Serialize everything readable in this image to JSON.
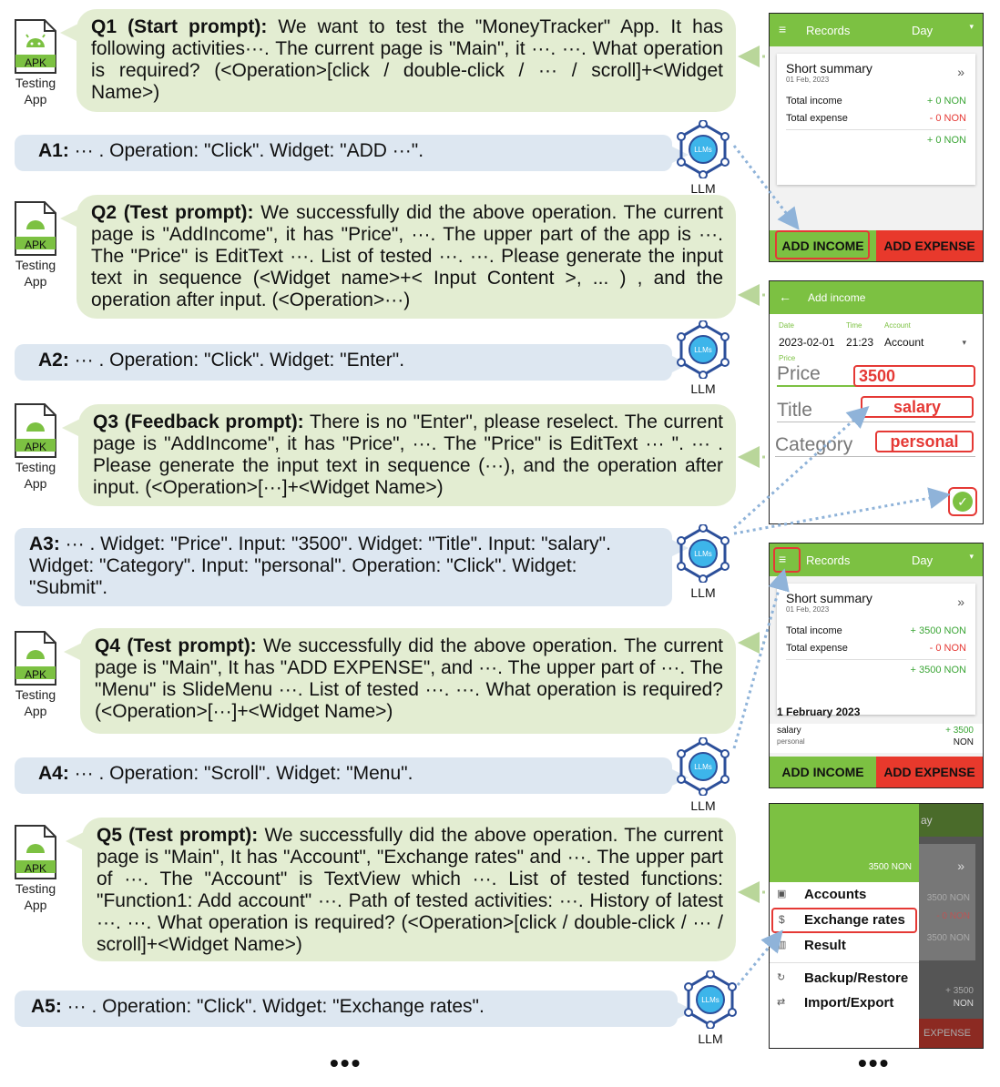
{
  "apk": {
    "badge": "APK",
    "label1": "Testing",
    "label2": "App"
  },
  "llm": {
    "inner": "LLMs",
    "label": "LLM"
  },
  "q1": {
    "title": "Q1 (Start prompt):",
    "text": " We want to test the \"MoneyTracker\" App. It has following activities···. The current page is \"Main\", it ···. ···. What operation is required? (<Operation>[click / double-click / ··· / scroll]+<Widget Name>)"
  },
  "a1": {
    "title": "A1:",
    "text": " ··· . Operation: \"Click\". Widget: \"ADD ···\"."
  },
  "q2": {
    "title": "Q2 (Test prompt):",
    "text": " We successfully did the above operation. The current page is \"AddIncome\", it has \"Price\", ···. The upper part of the app is ···. The \"Price\" is EditText ···. List of tested ···. ···. Please generate the input text in sequence (<Widget name>+< Input Content >, ... ) , and the operation after input. (<Operation>···)"
  },
  "a2": {
    "title": "A2:",
    "text": " ··· .  Operation: \"Click\". Widget: \"Enter\"."
  },
  "q3": {
    "title": "Q3 (Feedback prompt):",
    "text": " There is no \"Enter\", please reselect. The current page is \"AddIncome\", it has \"Price\", ···. The \"Price\" is EditText ··· \". ··· . Please generate the input text in sequence (···), and the operation after input. (<Operation>[···]+<Widget Name>)"
  },
  "a3": {
    "title": "A3:",
    "text": " ··· . Widget: \"Price\". Input: \"3500\". Widget: \"Title\". Input: \"salary\". Widget: \"Category\". Input: \"personal\". Operation: \"Click\". Widget: \"Submit\"."
  },
  "q4": {
    "title": "Q4 (Test prompt):",
    "text": " We successfully did the above operation. The current page is \"Main\", It has \"ADD EXPENSE\", and ···. The upper part of  ···. The \"Menu\" is SlideMenu ···. List of tested ···. ···. What operation is required? (<Operation>[···]+<Widget Name>)"
  },
  "a4": {
    "title": "A4:",
    "text": " ··· . Operation: \"Scroll\". Widget: \"Menu\"."
  },
  "q5": {
    "title": "Q5 (Test prompt):",
    "text": " We successfully did the above operation. The current page is \"Main\", It has \"Account\", \"Exchange rates\" and ···. The upper part of ···. The \"Account\" is TextView which ···. List of tested functions: \"Function1: Add account\" ···. Path of tested activities: ···. History of latest ···. ···. What operation is required? (<Operation>[click / double-click / ··· / scroll]+<Widget Name>)"
  },
  "a5": {
    "title": "A5:",
    "text": " ··· . Operation: \"Click\". Widget: \"Exchange rates\"."
  },
  "dots": "•••",
  "s1": {
    "bar_title": "Records",
    "bar_period": "Day",
    "card_title": "Short summary",
    "date": "01 Feb, 2023",
    "income_label": "Total income",
    "income_val": "+ 0 NON",
    "expense_label": "Total expense",
    "expense_val": "- 0 NON",
    "total_val": "+ 0 NON",
    "add_income": "ADD INCOME",
    "add_expense": "ADD EXPENSE",
    "chev": "»"
  },
  "s2": {
    "bar_title": "Add income",
    "date_lbl": "Date",
    "time_lbl": "Time",
    "account_lbl": "Account",
    "date": "2023-02-01",
    "time": "21:23",
    "account": "Account",
    "price_small": "Price",
    "price": "Price",
    "price_val": "3500",
    "title": "Title",
    "title_val": "salary",
    "category": "Category",
    "category_val": "personal"
  },
  "s3": {
    "bar_title": "Records",
    "bar_period": "Day",
    "card_title": "Short summary",
    "date": "01 Feb, 2023",
    "income_label": "Total income",
    "income_val": "+ 3500 NON",
    "expense_label": "Total expense",
    "expense_val": "- 0 NON",
    "total_val": "+ 3500 NON",
    "day_header": "1 February 2023",
    "item_title": "salary",
    "item_cat": "personal",
    "item_amt": "+ 3500",
    "item_cur": "NON",
    "add_income": "ADD INCOME",
    "add_expense": "ADD EXPENSE",
    "chev": "»"
  },
  "s4": {
    "balance": "3500 NON",
    "items": [
      "Accounts",
      "Exchange rates",
      "Result",
      "Backup/Restore",
      "Import/Export"
    ],
    "bg_period": "ay",
    "bg_v1": "3500 NON",
    "bg_v2": "- 0 NON",
    "bg_v3": "3500 NON",
    "bg_v4": "+ 3500",
    "bg_v5": "NON",
    "bg_btn": "EXPENSE",
    "chev": "»"
  }
}
